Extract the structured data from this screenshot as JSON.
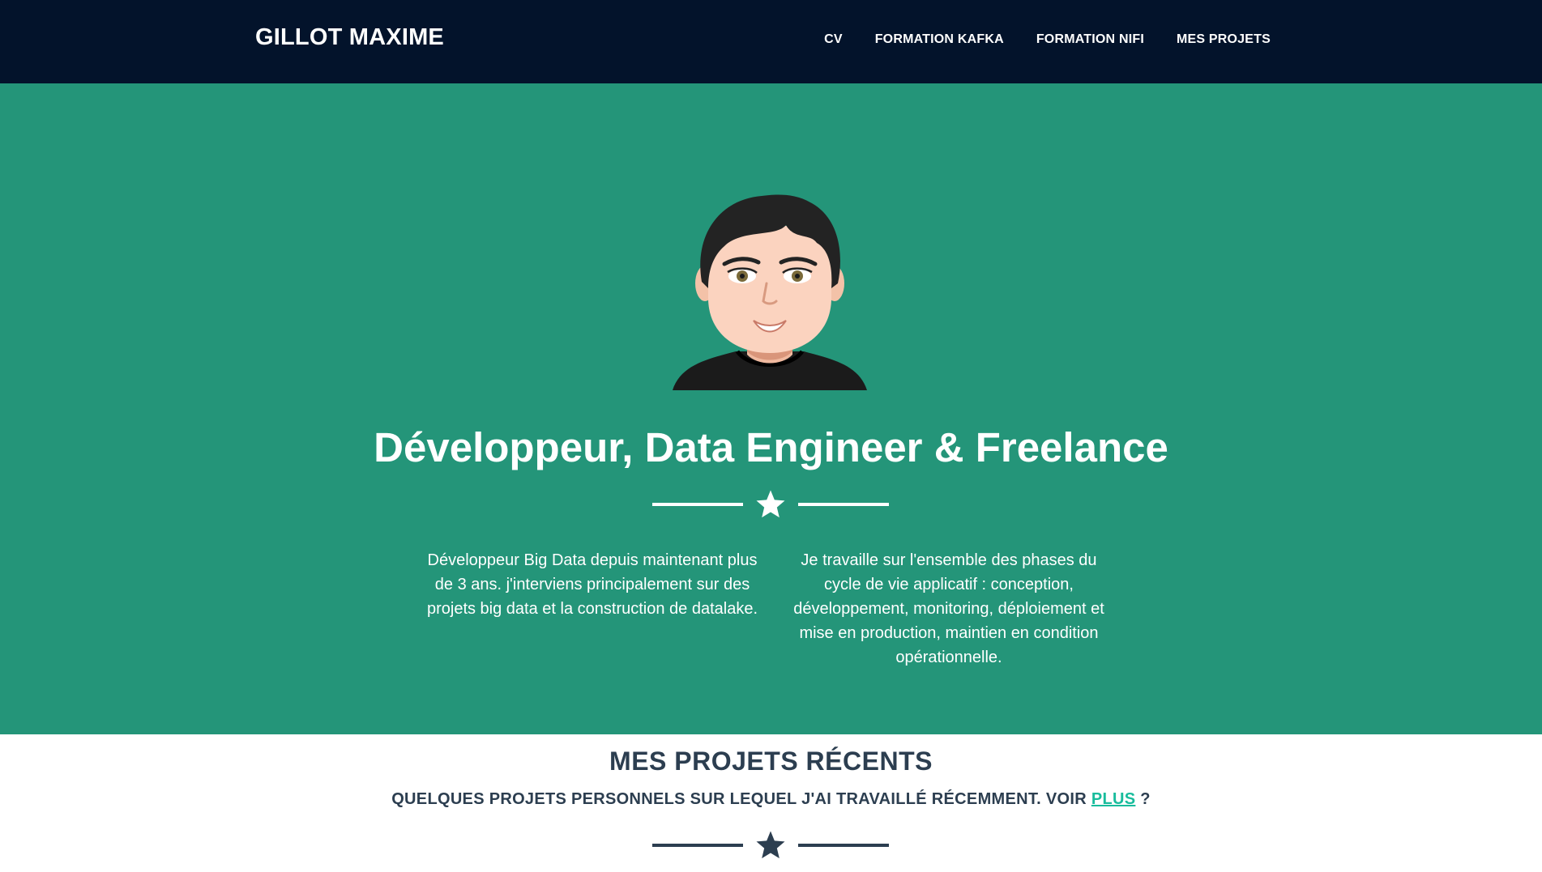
{
  "navbar": {
    "brand": "GILLOT MAXIME",
    "links": [
      "CV",
      "FORMATION KAFKA",
      "FORMATION NIFI",
      "MES PROJETS"
    ]
  },
  "hero": {
    "title": "Développeur, Data Engineer & Freelance",
    "intro_left": "Développeur Big Data depuis maintenant plus de 3 ans. j'interviens principalement sur des projets big data et la construction de datalake.",
    "intro_right": "Je travaille sur l'ensemble des phases du cycle de vie applicatif : conception, développement, monitoring, déploiement et mise en production, maintien en condition opérationnelle."
  },
  "projects": {
    "title": "MES PROJETS RÉCENTS",
    "subtitle_prefix": "QUELQUES PROJETS PERSONNELS SUR LEQUEL J'AI TRAVAILLÉ RÉCEMMENT. VOIR",
    "subtitle_link": "PLUS",
    "subtitle_suffix": "?"
  },
  "icons": {
    "avatar": "cartoon-man-avatar-icon",
    "divider_star": "star-icon"
  },
  "colors": {
    "navbar_bg": "#03132b",
    "hero_bg": "#249579",
    "heading_dark": "#2c3e50",
    "link_accent": "#18bc9c"
  }
}
